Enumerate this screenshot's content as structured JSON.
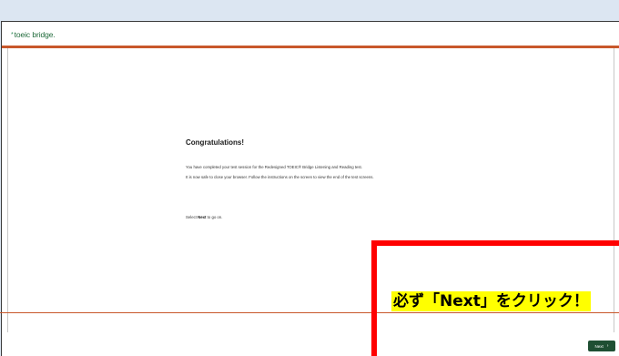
{
  "header": {
    "logo_mark": "*",
    "logo_text": "toeic bridge."
  },
  "main": {
    "heading": "Congratulations!",
    "para1": "You have completed your test session for the Redesigned TOEIC® Bridge Listening and Reading test.",
    "para2": "It is now safe to close your browser. Follow the instructions on the screen to view the end of the test screens.",
    "para3_prefix": "Select ",
    "para3_bold": "Next",
    "para3_suffix": " to go on."
  },
  "footer": {
    "next_label": "Next",
    "next_chevron": "›"
  },
  "annotation": {
    "callout_text": "必ず「Next」をクリック！",
    "box_color": "#ff0000",
    "highlight_color": "#ffff00"
  },
  "colors": {
    "brand_green": "#1f4f33",
    "accent_orange": "#c8572b",
    "outer_background": "#dce6f2"
  }
}
